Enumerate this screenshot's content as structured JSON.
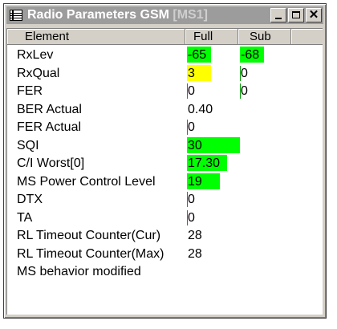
{
  "window": {
    "title": "Radio Parameters GSM",
    "title_sub": " [MS1]",
    "buttons": {
      "minimize": "_",
      "maximize": "□",
      "close": "✕"
    }
  },
  "table": {
    "columns": [
      "Element",
      "Full",
      "Sub"
    ],
    "rows": [
      {
        "element": "RxLev",
        "full": "-65",
        "sub": "-68",
        "full_color": "#00ff00",
        "sub_color": "#00ff00",
        "full_level": 0.45,
        "sub_level": 0.45
      },
      {
        "element": "RxQual",
        "full": "3",
        "sub": "0",
        "full_color": "#ffff00",
        "sub_color": "",
        "full_level": 0.45,
        "sub_level": 0
      },
      {
        "element": "FER",
        "full": "0",
        "sub": "0",
        "full_color": "",
        "sub_color": "",
        "full_level": 0,
        "sub_level": 0
      },
      {
        "element": "BER Actual",
        "full": "0.40",
        "sub": "",
        "full_color": "",
        "sub_color": "",
        "full_level": 0,
        "sub_level": 0
      },
      {
        "element": "FER Actual",
        "full": "0",
        "sub": "",
        "full_color": "",
        "sub_color": "",
        "full_level": 0,
        "sub_level": 0
      },
      {
        "element": "SQI",
        "full": "30",
        "sub": "",
        "full_color": "#00ff00",
        "sub_color": "",
        "full_level": 1.0,
        "sub_level": 0
      },
      {
        "element": "C/I Worst[0]",
        "full": "17.30",
        "sub": "",
        "full_color": "#00ff00",
        "sub_color": "",
        "full_level": 0.75,
        "sub_level": 0
      },
      {
        "element": "MS Power Control Level",
        "full": "19",
        "sub": "",
        "full_color": "#00ff00",
        "sub_color": "",
        "full_level": 0.62,
        "sub_level": 0
      },
      {
        "element": "DTX",
        "full": "0",
        "sub": "",
        "full_color": "",
        "sub_color": "",
        "full_level": 0,
        "sub_level": 0
      },
      {
        "element": "TA",
        "full": "0",
        "sub": "",
        "full_color": "",
        "sub_color": "",
        "full_level": 0,
        "sub_level": 0
      },
      {
        "element": "RL Timeout Counter(Cur)",
        "full": "28",
        "sub": "",
        "full_color": "",
        "sub_color": "",
        "full_level": 0,
        "sub_level": 0
      },
      {
        "element": "RL Timeout Counter(Max)",
        "full": "28",
        "sub": "",
        "full_color": "",
        "sub_color": "",
        "full_level": 0,
        "sub_level": 0
      },
      {
        "element": "MS behavior modified",
        "full": "",
        "sub": "",
        "full_color": "",
        "sub_color": "",
        "full_level": 0,
        "sub_level": 0
      }
    ]
  },
  "tick_rows": {
    "full": [
      0,
      1,
      2,
      4,
      5,
      6,
      7,
      8,
      9
    ],
    "sub": [
      0,
      1,
      2
    ]
  }
}
